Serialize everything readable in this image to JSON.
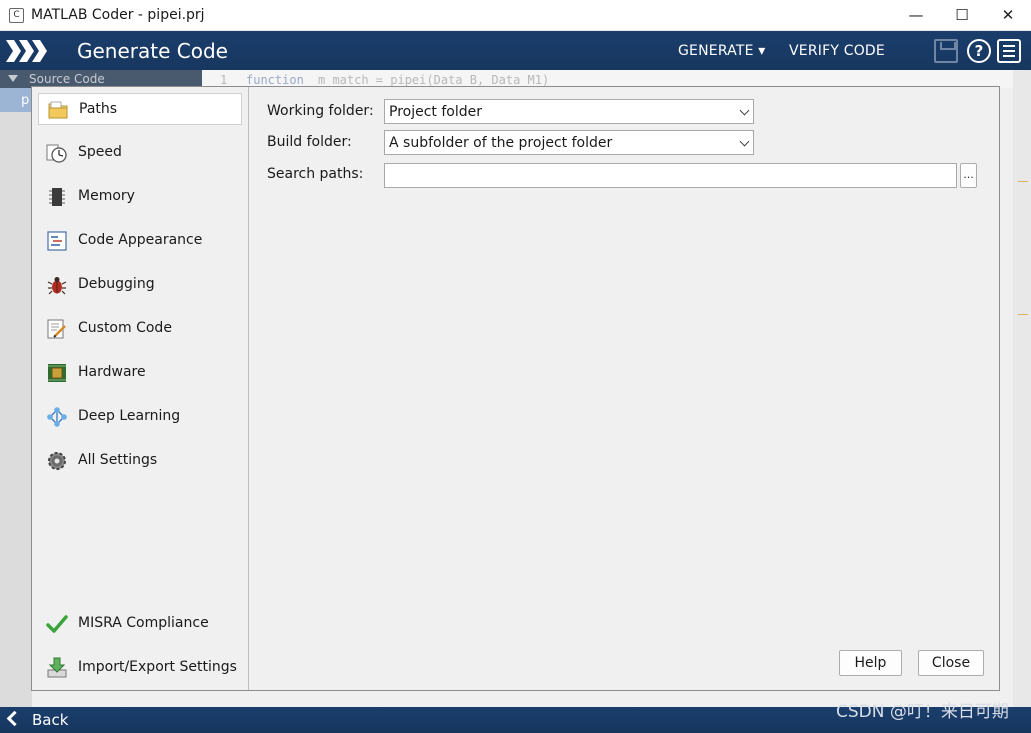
{
  "window": {
    "title": "MATLAB Coder - pipei.prj",
    "app_icon_letter": "C",
    "minimize_glyph": "—",
    "maximize_glyph": "☐",
    "close_glyph": "✕"
  },
  "header": {
    "title": "Generate Code",
    "menu_generate": "GENERATE ▾",
    "menu_verify": "VERIFY CODE",
    "help_glyph": "?"
  },
  "background": {
    "source_code_label": "Source Code",
    "selected_file_initial": "p",
    "code_line_number": "1",
    "code_keyword": "function",
    "code_rest": "m_match = pipei(Data_B, Data_M1)"
  },
  "sidebar": {
    "items": [
      {
        "label": "Paths",
        "icon": "folder-icon"
      },
      {
        "label": "Speed",
        "icon": "stopwatch-icon"
      },
      {
        "label": "Memory",
        "icon": "memory-chip-icon"
      },
      {
        "label": "Code Appearance",
        "icon": "code-appearance-icon"
      },
      {
        "label": "Debugging",
        "icon": "bug-icon"
      },
      {
        "label": "Custom Code",
        "icon": "custom-code-icon"
      },
      {
        "label": "Hardware",
        "icon": "hardware-board-icon"
      },
      {
        "label": "Deep Learning",
        "icon": "neural-network-icon"
      },
      {
        "label": "All Settings",
        "icon": "gear-icon"
      },
      {
        "label": "MISRA Compliance",
        "icon": "checkmark-icon"
      },
      {
        "label": "Import/Export Settings",
        "icon": "import-export-icon"
      }
    ]
  },
  "paths": {
    "working_folder_label": "Working folder:",
    "working_folder_value": "Project folder",
    "build_folder_label": "Build folder:",
    "build_folder_value": "A subfolder of the project folder",
    "search_paths_label": "Search paths:",
    "search_paths_value": "",
    "browse_label": "..."
  },
  "buttons": {
    "help": "Help",
    "close": "Close"
  },
  "footer": {
    "back_label": "Back"
  },
  "watermark": "CSDN @叮！来日可期",
  "colors": {
    "header_blue": "#1a3d6b",
    "dialog_bg": "#f0f0f0",
    "selected_item_bg": "#ffffff"
  }
}
